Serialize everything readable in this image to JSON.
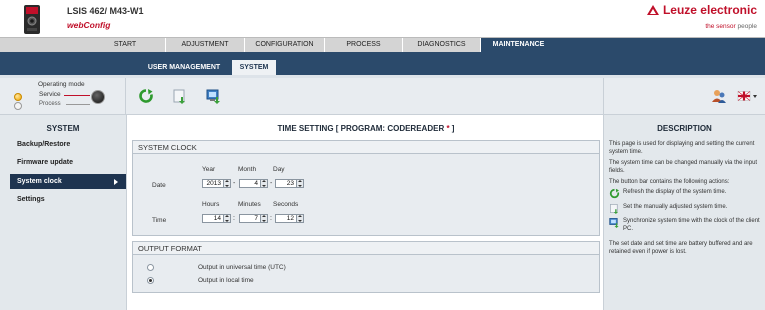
{
  "header": {
    "device_name": "LSIS 462/ M43-W1",
    "app_name": "webConfig",
    "brand": "Leuze electronic",
    "tagline_red": "the sensor",
    "tagline_grey": " people"
  },
  "main_tabs": [
    {
      "label": "START"
    },
    {
      "label": "ADJUSTMENT"
    },
    {
      "label": "CONFIGURATION"
    },
    {
      "label": "PROCESS"
    },
    {
      "label": "DIAGNOSTICS"
    },
    {
      "label": "MAINTENANCE",
      "active": true
    }
  ],
  "sub_tabs": [
    {
      "label": "USER MANAGEMENT"
    },
    {
      "label": "SYSTEM",
      "active": true
    }
  ],
  "operating_mode": {
    "title": "Operating mode",
    "service": "Service",
    "process": "Process"
  },
  "toolbar_icons": [
    "refresh-icon",
    "set-time-icon",
    "sync-time-icon",
    "user-icon",
    "language-flag-icon"
  ],
  "sidebar": {
    "title": "SYSTEM",
    "items": [
      {
        "label": "Backup/Restore"
      },
      {
        "label": "Firmware update"
      },
      {
        "label": "System clock",
        "active": true
      },
      {
        "label": "Settings"
      }
    ]
  },
  "content": {
    "title": "TIME SETTING   [ PROGRAM: CODEREADER ",
    "title_star": "*",
    "title_end": " ]",
    "clock_panel": {
      "title": "SYSTEM CLOCK",
      "date_label": "Date",
      "time_label": "Time",
      "year_label": "Year",
      "month_label": "Month",
      "day_label": "Day",
      "hours_label": "Hours",
      "minutes_label": "Minutes",
      "seconds_label": "Seconds",
      "year": "2013",
      "month": "4",
      "day": "23",
      "hours": "14",
      "minutes": "7",
      "seconds": "12",
      "date_sep": "-",
      "time_sep": ":"
    },
    "format_panel": {
      "title": "OUTPUT FORMAT",
      "options": [
        {
          "label": "Output in universal time (UTC)",
          "checked": false
        },
        {
          "label": "Output in local time",
          "checked": true
        }
      ]
    }
  },
  "description": {
    "title": "DESCRIPTION",
    "p1": "This page is used for displaying and setting the current system time.",
    "p2": "The system time can be changed manually via the input fields.",
    "p3": "The button bar contains the following actions:",
    "action1": "Refresh the display of the system time.",
    "action2": "Set the manually adjusted system time.",
    "action3": "Synchronize system time with the clock of the client PC.",
    "p4": "The set date and set time are battery buffered and are retained even if power is lost."
  },
  "colors": {
    "brand_red": "#c0102a",
    "nav_blue": "#2b4a6b",
    "panel_bg": "#e8ecf0"
  }
}
